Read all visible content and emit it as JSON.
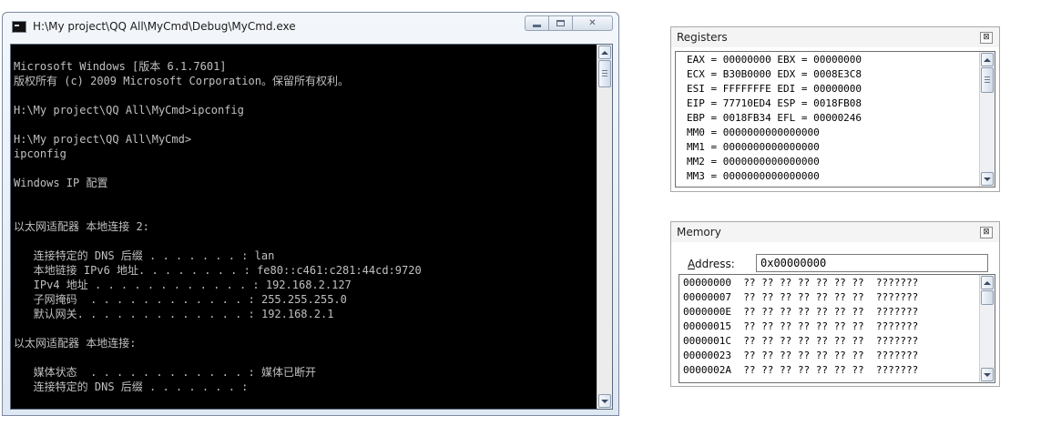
{
  "console": {
    "title": "H:\\My project\\QQ All\\MyCmd\\Debug\\MyCmd.exe",
    "lines": [
      "Microsoft Windows [版本 6.1.7601]",
      "版权所有 (c) 2009 Microsoft Corporation。保留所有权利。",
      "",
      "H:\\My project\\QQ All\\MyCmd>ipconfig",
      "",
      "H:\\My project\\QQ All\\MyCmd>",
      "ipconfig",
      "",
      "Windows IP 配置",
      "",
      "",
      "以太网适配器 本地连接 2:",
      "",
      "   连接特定的 DNS 后缀 . . . . . . . : lan",
      "   本地链接 IPv6 地址. . . . . . . . : fe80::c461:c281:44cd:9720",
      "   IPv4 地址 . . . . . . . . . . . . : 192.168.2.127",
      "   子网掩码  . . . . . . . . . . . . : 255.255.255.0",
      "   默认网关. . . . . . . . . . . . . : 192.168.2.1",
      "",
      "以太网适配器 本地连接:",
      "",
      "   媒体状态  . . . . . . . . . . . . : 媒体已断开",
      "   连接特定的 DNS 后缀 . . . . . . . :"
    ],
    "text_color": "#c0c0c0",
    "background_color": "#000000",
    "icons": {
      "app": "console-app-icon",
      "minimize": "minimize-icon",
      "maximize": "maximize-icon",
      "close": "close-icon"
    },
    "close_glyph": "✕"
  },
  "registers": {
    "title": "Registers",
    "close_glyph": "⊠",
    "lines": [
      "EAX = 00000000 EBX = 00000000",
      "ECX = B30B0000 EDX = 0008E3C8",
      "ESI = FFFFFFFE EDI = 00000000",
      "EIP = 77710ED4 ESP = 0018FB08",
      "EBP = 0018FB34 EFL = 00000246",
      "MM0 = 0000000000000000",
      "MM1 = 0000000000000000",
      "MM2 = 0000000000000000",
      "MM3 = 0000000000000000"
    ]
  },
  "memory": {
    "title": "Memory",
    "close_glyph": "⊠",
    "address_label_underlined": "A",
    "address_label_rest": "ddress:",
    "address_value": "0x00000000",
    "rows": [
      "00000000  ?? ?? ?? ?? ?? ?? ??  ???????",
      "00000007  ?? ?? ?? ?? ?? ?? ??  ???????",
      "0000000E  ?? ?? ?? ?? ?? ?? ??  ???????",
      "00000015  ?? ?? ?? ?? ?? ?? ??  ???????",
      "0000001C  ?? ?? ?? ?? ?? ?? ??  ???????",
      "00000023  ?? ?? ?? ?? ?? ?? ??  ???????",
      "0000002A  ?? ?? ?? ?? ?? ?? ??  ???????"
    ]
  }
}
